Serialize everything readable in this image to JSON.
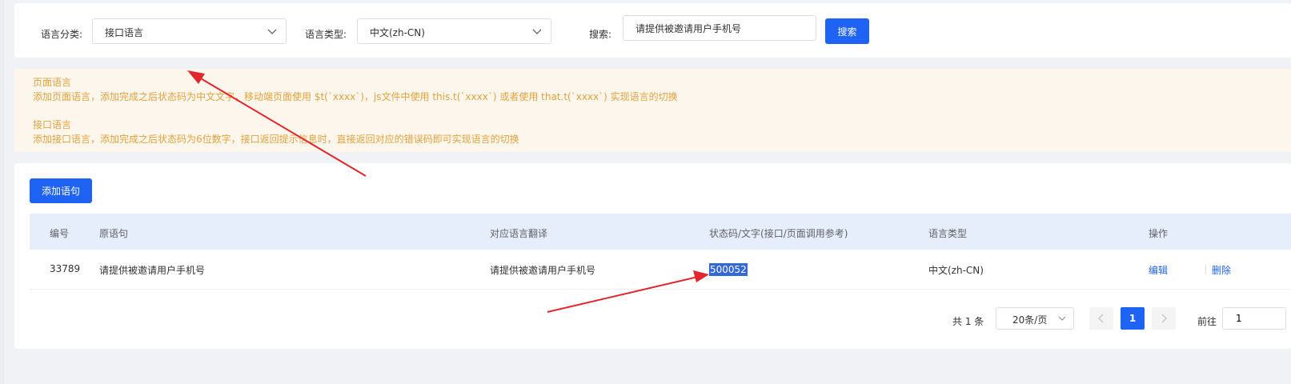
{
  "filters": {
    "category_label": "语言分类:",
    "category_value": "接口语言",
    "type_label": "语言类型:",
    "type_value": "中文(zh-CN)",
    "search_label": "搜索:",
    "search_value": "请提供被邀请用户手机号",
    "search_button": "搜索"
  },
  "notice": {
    "page_title": "页面语言",
    "page_desc": "添加页面语言，添加完成之后状态码为中文文字，移动端页面使用 $t(`xxxx`)，js文件中使用 this.t(`xxxx`) 或者使用 that.t(`xxxx`) 实现语言的切换",
    "api_title": "接口语言",
    "api_desc": "添加接口语言，添加完成之后状态码为6位数字，接口返回提示信息时，直接返回对应的错误码即可实现语言的切换"
  },
  "table": {
    "add_button": "添加语句",
    "columns": [
      "编号",
      "原语句",
      "对应语言翻译",
      "状态码/文字(接口/页面调用参考)",
      "语言类型",
      "操作"
    ],
    "rows": [
      {
        "id": "33789",
        "source": "请提供被邀请用户手机号",
        "translation": "请提供被邀请用户手机号",
        "code": "500052",
        "lang": "中文(zh-CN)",
        "edit": "编辑",
        "delete": "删除"
      }
    ]
  },
  "pagination": {
    "total": "共 1 条",
    "page_size": "20条/页",
    "current_page": "1",
    "goto_label": "前往",
    "goto_value": "1"
  },
  "colors": {
    "primary": "#1f63f5",
    "notice_text": "#e6a23c",
    "notice_bg": "#fdf6ec",
    "annotation_arrow": "#e3262b"
  }
}
